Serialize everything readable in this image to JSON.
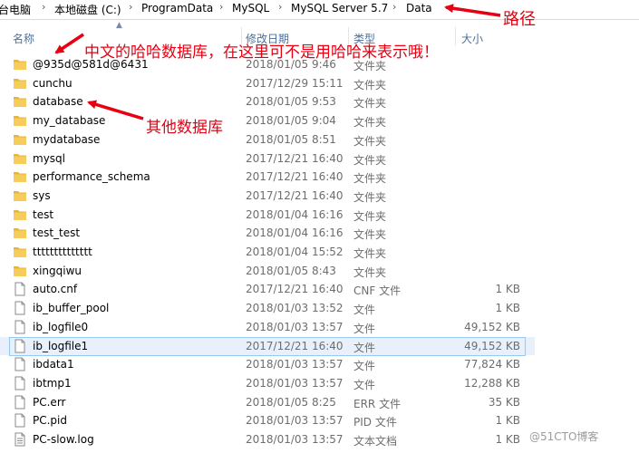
{
  "breadcrumb": {
    "items": [
      "台电脑",
      "本地磁盘 (C:)",
      "ProgramData",
      "MySQL",
      "MySQL Server 5.7",
      "Data"
    ],
    "separator": "›"
  },
  "columns": {
    "name": "名称",
    "date": "修改日期",
    "type": "类型",
    "size": "大小"
  },
  "files": [
    {
      "name": "@935d@581d@6431",
      "date": "2018/01/05 9:46",
      "type": "文件夹",
      "size": "",
      "icon": "folder-icon"
    },
    {
      "name": "cunchu",
      "date": "2017/12/29 15:11",
      "type": "文件夹",
      "size": "",
      "icon": "folder-icon"
    },
    {
      "name": "database",
      "date": "2018/01/05 9:53",
      "type": "文件夹",
      "size": "",
      "icon": "folder-icon"
    },
    {
      "name": "my_database",
      "date": "2018/01/05 9:04",
      "type": "文件夹",
      "size": "",
      "icon": "folder-icon"
    },
    {
      "name": "mydatabase",
      "date": "2018/01/05 8:51",
      "type": "文件夹",
      "size": "",
      "icon": "folder-icon"
    },
    {
      "name": "mysql",
      "date": "2017/12/21 16:40",
      "type": "文件夹",
      "size": "",
      "icon": "folder-icon"
    },
    {
      "name": "performance_schema",
      "date": "2017/12/21 16:40",
      "type": "文件夹",
      "size": "",
      "icon": "folder-icon"
    },
    {
      "name": "sys",
      "date": "2017/12/21 16:40",
      "type": "文件夹",
      "size": "",
      "icon": "folder-icon"
    },
    {
      "name": "test",
      "date": "2018/01/04 16:16",
      "type": "文件夹",
      "size": "",
      "icon": "folder-icon"
    },
    {
      "name": "test_test",
      "date": "2018/01/04 16:16",
      "type": "文件夹",
      "size": "",
      "icon": "folder-icon"
    },
    {
      "name": "tttttttttttttt",
      "date": "2018/01/04 15:52",
      "type": "文件夹",
      "size": "",
      "icon": "folder-icon"
    },
    {
      "name": "xingqiwu",
      "date": "2018/01/05 8:43",
      "type": "文件夹",
      "size": "",
      "icon": "folder-icon"
    },
    {
      "name": "auto.cnf",
      "date": "2017/12/21 16:40",
      "type": "CNF 文件",
      "size": "1 KB",
      "icon": "file-icon"
    },
    {
      "name": "ib_buffer_pool",
      "date": "2018/01/03 13:52",
      "type": "文件",
      "size": "1 KB",
      "icon": "file-icon"
    },
    {
      "name": "ib_logfile0",
      "date": "2018/01/03 13:57",
      "type": "文件",
      "size": "49,152 KB",
      "icon": "file-icon"
    },
    {
      "name": "ib_logfile1",
      "date": "2017/12/21 16:40",
      "type": "文件",
      "size": "49,152 KB",
      "icon": "file-icon",
      "selected": true
    },
    {
      "name": "ibdata1",
      "date": "2018/01/03 13:57",
      "type": "文件",
      "size": "77,824 KB",
      "icon": "file-icon"
    },
    {
      "name": "ibtmp1",
      "date": "2018/01/03 13:57",
      "type": "文件",
      "size": "12,288 KB",
      "icon": "file-icon"
    },
    {
      "name": "PC.err",
      "date": "2018/01/05 8:25",
      "type": "ERR 文件",
      "size": "35 KB",
      "icon": "file-icon"
    },
    {
      "name": "PC.pid",
      "date": "2018/01/03 13:57",
      "type": "PID 文件",
      "size": "1 KB",
      "icon": "file-icon"
    },
    {
      "name": "PC-slow.log",
      "date": "2018/01/03 13:57",
      "type": "文本文档",
      "size": "1 KB",
      "icon": "text-file-icon"
    }
  ],
  "annotations": {
    "path_label": "路径",
    "chinese_db_label": "中文的哈哈数据库，在这里可不是用哈哈来表示哦！",
    "other_db_label": "其他数据库"
  },
  "colors": {
    "annotation_red": "#e60012",
    "folder_yellow": "#f3c24f",
    "selection_bg": "#e8f1fb",
    "selection_border": "#99c9ef"
  },
  "watermark": "@51CTO博客"
}
